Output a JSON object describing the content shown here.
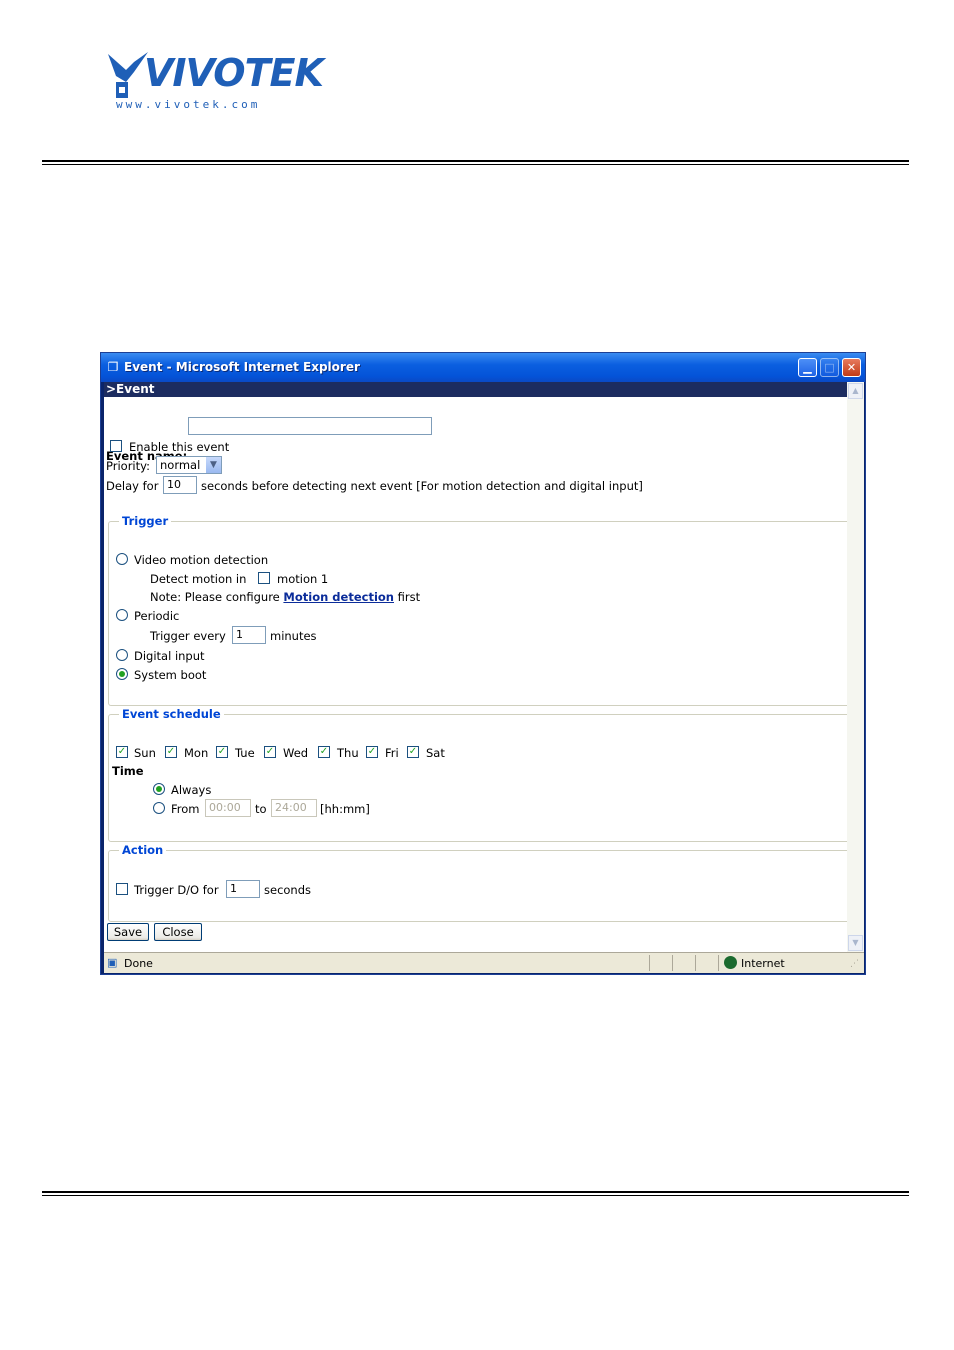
{
  "logo": {
    "brand": "VIVOTEK",
    "url": "www.vivotek.com"
  },
  "window": {
    "title": "Event - Microsoft Internet Explorer",
    "status_text": "Done",
    "zone_text": "Internet"
  },
  "page": {
    "header": ">Event",
    "event_name_label": "Event name:",
    "event_name_value": "",
    "enable_label": "Enable this event",
    "enable_checked": false,
    "priority_label": "Priority:",
    "priority_value": "normal",
    "delay_label_pre": "Delay for",
    "delay_value": "10",
    "delay_label_post": "seconds before detecting next event [For motion detection and digital input]"
  },
  "trigger": {
    "legend": "Trigger",
    "video_motion_label": "Video motion detection",
    "detect_motion_label": "Detect motion in",
    "motion1_label": "motion 1",
    "note_pre": "Note: Please configure",
    "note_link": "Motion detection",
    "note_post": "first",
    "periodic_label": "Periodic",
    "trigger_every_label": "Trigger every",
    "trigger_every_value": "1",
    "minutes_label": "minutes",
    "digital_input_label": "Digital input",
    "system_boot_label": "System boot",
    "selected": "System boot"
  },
  "schedule": {
    "legend": "Event schedule",
    "days": [
      {
        "label": "Sun",
        "checked": true
      },
      {
        "label": "Mon",
        "checked": true
      },
      {
        "label": "Tue",
        "checked": true
      },
      {
        "label": "Wed",
        "checked": true
      },
      {
        "label": "Thu",
        "checked": true
      },
      {
        "label": "Fri",
        "checked": true
      },
      {
        "label": "Sat",
        "checked": true
      }
    ],
    "time_label": "Time",
    "always_label": "Always",
    "from_label": "From",
    "from_value": "00:00",
    "to_label": "to",
    "to_value": "24:00",
    "format_label": "[hh:mm]",
    "selected": "Always"
  },
  "action": {
    "legend": "Action",
    "trigger_do_label": "Trigger D/O for",
    "trigger_do_value": "1",
    "seconds_label": "seconds",
    "trigger_do_checked": false
  },
  "buttons": {
    "save": "Save",
    "close": "Close"
  },
  "colors": {
    "accent": "#0046d5",
    "header_bar": "#1c2c60",
    "brand": "#1f5fb7",
    "check": "#21a121"
  }
}
